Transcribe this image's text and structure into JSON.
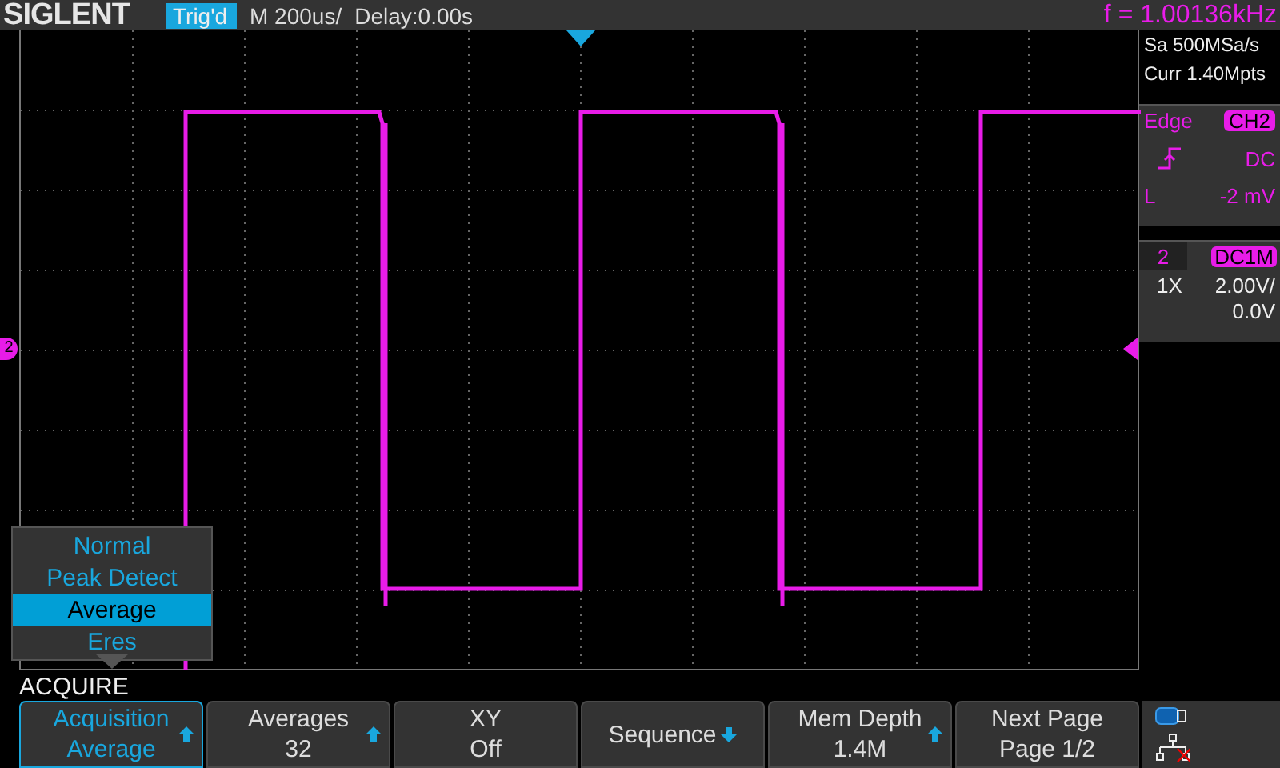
{
  "header": {
    "logo": "SIGLENT",
    "trigger_status": "Trig'd",
    "timebase": "M 200us/",
    "delay": "Delay:0.00s",
    "frequency": "f = 1.00136kHz"
  },
  "acquisition": {
    "sample_rate": "Sa 500MSa/s",
    "memory": "Curr 1.40Mpts"
  },
  "trigger": {
    "type": "Edge",
    "source": "CH2",
    "coupling": "DC",
    "level_label": "L",
    "level_reading": "-2 mV"
  },
  "channel": {
    "number": "2",
    "coupling": "DC1M",
    "probe": "1X",
    "scale": "2.00V/",
    "offset": "0.0V"
  },
  "waveform": {
    "channel_marker": "2"
  },
  "mode_menu": {
    "items": [
      {
        "label": "Normal",
        "selected": false
      },
      {
        "label": "Peak Detect",
        "selected": false
      },
      {
        "label": "Average",
        "selected": true
      },
      {
        "label": "Eres",
        "selected": false
      }
    ]
  },
  "menu_title": "ACQUIRE",
  "softkeys": [
    {
      "label": "Acquisition",
      "value": "Average",
      "kind": "up",
      "selected": true
    },
    {
      "label": "Averages",
      "value": "32",
      "kind": "up",
      "selected": false
    },
    {
      "label": "XY",
      "value": "Off",
      "kind": "plain",
      "selected": false
    },
    {
      "label": "Sequence",
      "kind": "down",
      "selected": false
    },
    {
      "label": "Mem Depth",
      "value": "1.4M",
      "kind": "up",
      "selected": false
    },
    {
      "label": "Next Page",
      "value": "Page 1/2",
      "kind": "plain",
      "selected": false
    }
  ]
}
